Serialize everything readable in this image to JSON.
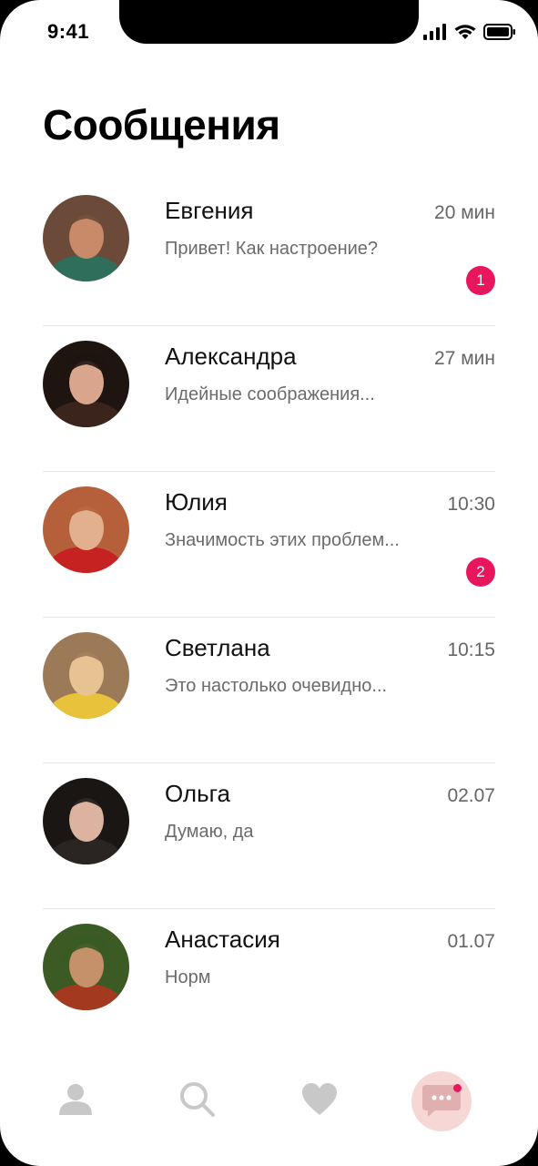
{
  "status_bar": {
    "time": "9:41"
  },
  "page": {
    "title": "Сообщения"
  },
  "conversations": [
    {
      "name": "Евгения",
      "time": "20 мин",
      "preview": "Привет! Как  настроение?",
      "unread": "1",
      "avatar_colors": [
        "#6b4a3a",
        "#c98a6a",
        "#2e6e5a"
      ]
    },
    {
      "name": "Александра",
      "time": "27 мин",
      "preview": "Идейные соображения...",
      "unread": null,
      "avatar_colors": [
        "#1e1410",
        "#d9a58c",
        "#3a241b"
      ]
    },
    {
      "name": "Юлия",
      "time": "10:30",
      "preview": "Значимость этих проблем...",
      "unread": "2",
      "avatar_colors": [
        "#b5603a",
        "#e2b08e",
        "#c72222"
      ]
    },
    {
      "name": "Светлана",
      "time": "10:15",
      "preview": "Это настолько очевидно...",
      "unread": null,
      "avatar_colors": [
        "#9c7a58",
        "#e7c293",
        "#e8c23b"
      ]
    },
    {
      "name": "Ольга",
      "time": "02.07",
      "preview": "Думаю, да",
      "unread": null,
      "avatar_colors": [
        "#1a1614",
        "#dcb3a0",
        "#2a2522"
      ]
    },
    {
      "name": "Анастасия",
      "time": "01.07",
      "preview": "Норм",
      "unread": null,
      "avatar_colors": [
        "#3b5a24",
        "#c5916a",
        "#a3391f"
      ]
    }
  ],
  "tabbar": {
    "items": [
      {
        "icon": "profile-icon",
        "active": false
      },
      {
        "icon": "search-icon",
        "active": false
      },
      {
        "icon": "heart-icon",
        "active": false
      },
      {
        "icon": "chat-icon",
        "active": true,
        "has_dot": true
      }
    ]
  },
  "colors": {
    "accent": "#e8175d",
    "active_tab_bg": "#f7d6d6",
    "icon_inactive": "#c8c8c8",
    "icon_active": "#e0b0b0"
  }
}
